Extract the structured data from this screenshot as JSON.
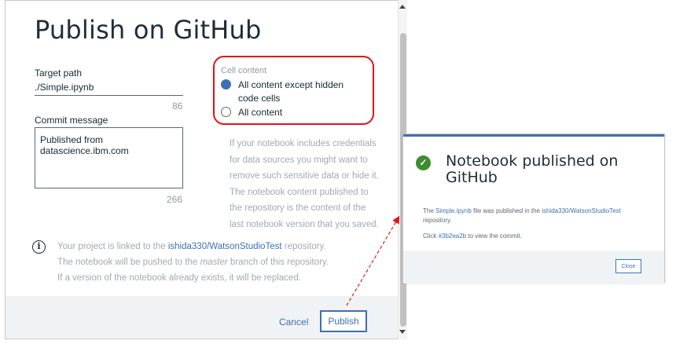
{
  "dialog": {
    "title": "Publish on GitHub",
    "target_path_label": "Target path",
    "target_path_value": "./Simple.ipynb",
    "target_path_counter": "86",
    "commit_label": "Commit message",
    "commit_value": "Published from datascience.ibm.com",
    "commit_counter": "266",
    "cell_content_label": "Cell content",
    "option_hidden": "All content except hidden code cells",
    "option_all": "All content",
    "help_text": "If your notebook includes credentials for data sources you might want to remove such sensitive data or hide it. The notebook content published to the repository is the content of the last notebook version that you saved.",
    "info": {
      "prefix": "Your project is linked to the ",
      "repo_link": "ishida330/WatsonStudioTest",
      "suffix": " repository.",
      "line2_prefix": "The notebook will be pushed to the ",
      "line2_branch": "master",
      "line2_suffix": " branch of this repository.",
      "line3": "If a version of the notebook already exists, it will be replaced."
    },
    "cancel_label": "Cancel",
    "publish_label": "Publish"
  },
  "notice": {
    "title": "Notebook published on GitHub",
    "text_prefix": "The ",
    "file_link": "Simple.ipynb",
    "text_middle": " file was published in the ",
    "repo_link": "ishida330/WatsonStudioTest",
    "text_suffix": " repository.",
    "click_prefix": "Click ",
    "commit_link": "#3b2ea2b",
    "click_suffix": " to view the commit.",
    "close_label": "Close"
  },
  "colors": {
    "accent": "#3d70b2",
    "highlight": "#e3121b",
    "success": "#3b8d2e"
  }
}
